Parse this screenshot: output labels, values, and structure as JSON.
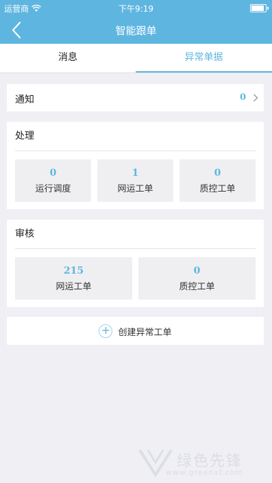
{
  "status_bar": {
    "carrier": "运营商",
    "time": "下午9:19"
  },
  "nav": {
    "title": "智能跟单"
  },
  "tabs": [
    {
      "label": "消息"
    },
    {
      "label": "异常单据"
    }
  ],
  "notice": {
    "label": "通知",
    "count": "0"
  },
  "processing": {
    "title": "处理",
    "items": [
      {
        "count": "0",
        "label": "运行调度"
      },
      {
        "count": "1",
        "label": "网运工单"
      },
      {
        "count": "0",
        "label": "质控工单"
      }
    ]
  },
  "review": {
    "title": "审核",
    "items": [
      {
        "count": "215",
        "label": "网运工单"
      },
      {
        "count": "0",
        "label": "质控工单"
      }
    ]
  },
  "create": {
    "label": "创建异常工单"
  },
  "watermark": {
    "text": "绿色先锋",
    "url": "www.greenxf.com"
  },
  "colors": {
    "accent": "#5eb6e0",
    "background": "#efeff4"
  }
}
